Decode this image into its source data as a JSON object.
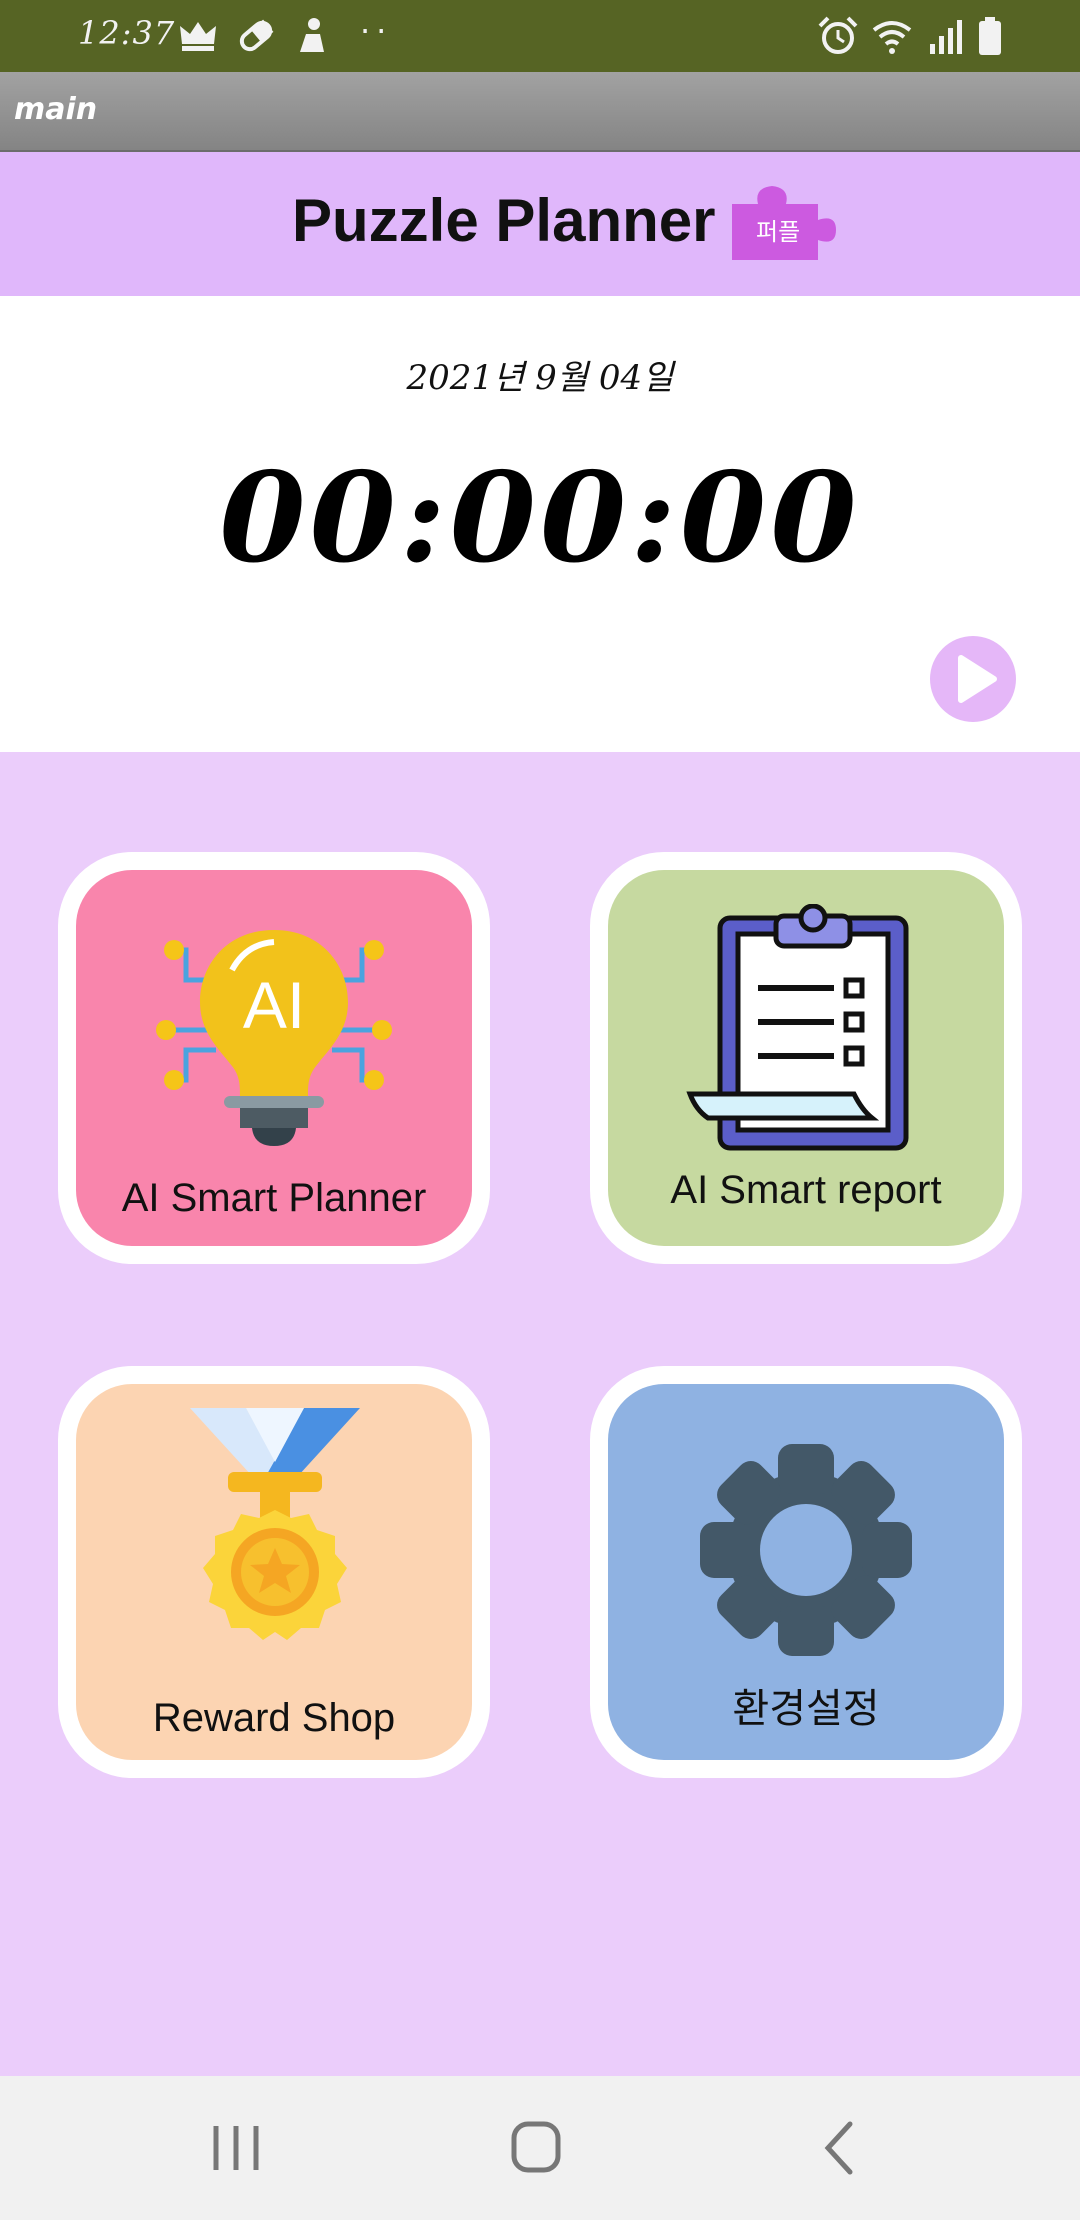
{
  "status_bar": {
    "time": "12:37",
    "dots": "··",
    "left_icons": [
      "crown-icon",
      "pill-icon",
      "person-icon"
    ],
    "right_icons": [
      "alarm-icon",
      "wifi-icon",
      "signal-icon",
      "battery-icon"
    ],
    "background": "#566424"
  },
  "app_bar": {
    "title": "main"
  },
  "header": {
    "title": "Puzzle Planner",
    "badge": "퍼플",
    "badge_icon": "puzzle-piece-icon",
    "background": "#e0b7fb",
    "badge_color": "#cc5ae0"
  },
  "timer": {
    "date": "2021년 9월 04일",
    "elapsed": "00:00:00",
    "play_icon": "play-icon"
  },
  "menu": {
    "tiles": [
      {
        "label": "AI Smart Planner",
        "icon": "ai-lightbulb-icon",
        "color": "#f985ac"
      },
      {
        "label": "AI Smart report",
        "icon": "clipboard-checklist-icon",
        "color": "#c6d9a0"
      },
      {
        "label": "Reward Shop",
        "icon": "medal-icon",
        "color": "#fcd4b2"
      },
      {
        "label": "환경설정",
        "icon": "gear-icon",
        "color": "#8fb2e2"
      }
    ],
    "background": "#ebcdfb"
  },
  "nav": {
    "buttons": [
      "recent-apps-icon",
      "home-icon",
      "back-icon"
    ]
  }
}
